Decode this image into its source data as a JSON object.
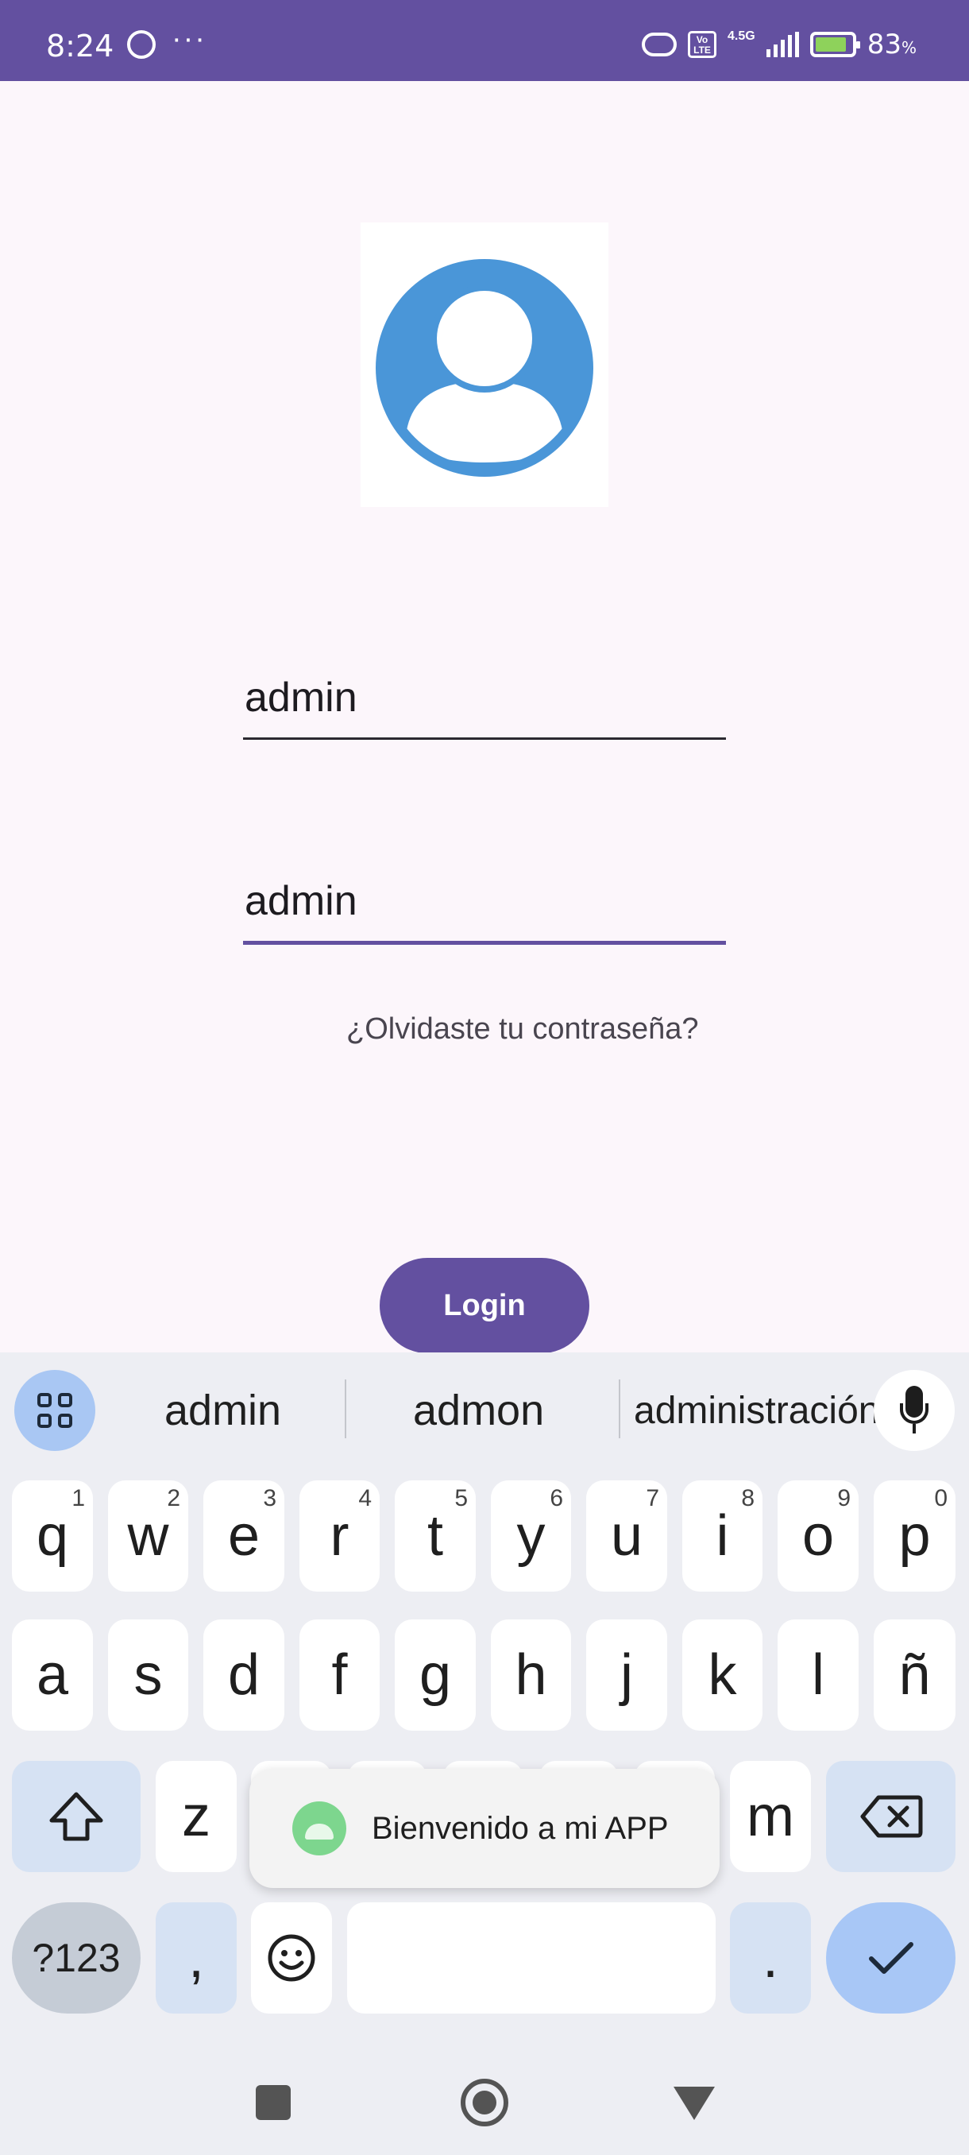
{
  "status_bar": {
    "time": "8:24",
    "more": "···",
    "network": "4.5G",
    "volte": "Vo LTE",
    "battery_pct": "83",
    "battery_unit": "%"
  },
  "form": {
    "username_value": "admin",
    "password_value": "admin",
    "forgot_link": "¿Olvidaste tu contraseña?",
    "login_button": "Login"
  },
  "keyboard": {
    "suggestions": [
      "admin",
      "admon",
      "administración"
    ],
    "row1": [
      {
        "k": "q",
        "h": "1"
      },
      {
        "k": "w",
        "h": "2"
      },
      {
        "k": "e",
        "h": "3"
      },
      {
        "k": "r",
        "h": "4"
      },
      {
        "k": "t",
        "h": "5"
      },
      {
        "k": "y",
        "h": "6"
      },
      {
        "k": "u",
        "h": "7"
      },
      {
        "k": "i",
        "h": "8"
      },
      {
        "k": "o",
        "h": "9"
      },
      {
        "k": "p",
        "h": "0"
      }
    ],
    "row2": [
      "a",
      "s",
      "d",
      "f",
      "g",
      "h",
      "j",
      "k",
      "l",
      "ñ"
    ],
    "row3_visible": [
      "z",
      "m"
    ],
    "symbols_key": "?123",
    "comma_key": ",",
    "period_key": "."
  },
  "toast": {
    "message": "Bienvenido a mi APP"
  },
  "colors": {
    "primary": "#6350a0",
    "avatar_blue": "#4a96d8",
    "background": "#fcf6fb",
    "keyboard_bg": "#edeef3"
  },
  "icons": [
    "whatsapp-icon",
    "hotspot-icon",
    "volte-icon",
    "signal-icon",
    "battery-icon",
    "avatar-icon",
    "apps-grid-icon",
    "mic-icon",
    "shift-icon",
    "backspace-icon",
    "emoji-icon",
    "check-icon",
    "android-icon",
    "recents-icon",
    "home-icon",
    "back-icon"
  ]
}
